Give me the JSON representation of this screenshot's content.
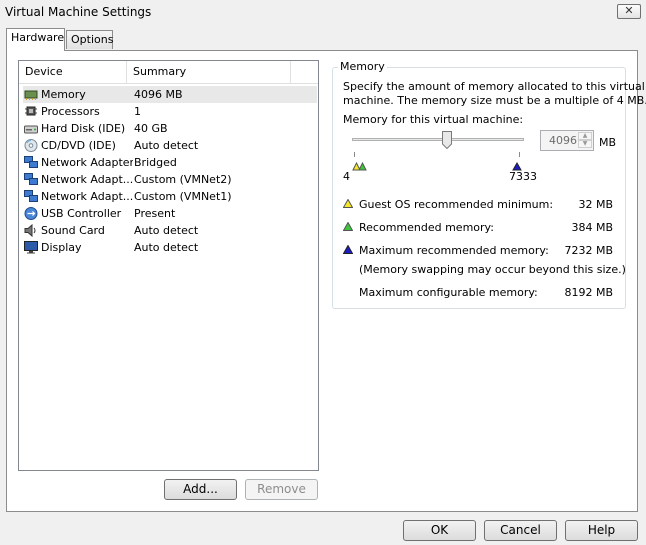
{
  "window": {
    "title": "Virtual Machine Settings"
  },
  "tabs": [
    {
      "label": "Hardware",
      "active": true
    },
    {
      "label": "Options",
      "active": false
    }
  ],
  "device_table": {
    "columns": [
      "Device",
      "Summary"
    ],
    "rows": [
      {
        "device": "Memory",
        "summary": "4096 MB",
        "icon": "memory-icon",
        "selected": true
      },
      {
        "device": "Processors",
        "summary": "1",
        "icon": "processor-icon"
      },
      {
        "device": "Hard Disk (IDE)",
        "summary": "40 GB",
        "icon": "hard-disk-icon"
      },
      {
        "device": "CD/DVD (IDE)",
        "summary": "Auto detect",
        "icon": "cd-dvd-icon"
      },
      {
        "device": "Network Adapter",
        "summary": "Bridged",
        "icon": "network-adapter-icon"
      },
      {
        "device": "Network Adapt...",
        "summary": "Custom (VMNet2)",
        "icon": "network-adapter-icon"
      },
      {
        "device": "Network Adapt...",
        "summary": "Custom (VMNet1)",
        "icon": "network-adapter-icon"
      },
      {
        "device": "USB Controller",
        "summary": "Present",
        "icon": "usb-icon"
      },
      {
        "device": "Sound Card",
        "summary": "Auto detect",
        "icon": "speaker-icon"
      },
      {
        "device": "Display",
        "summary": "Auto detect",
        "icon": "monitor-icon"
      }
    ]
  },
  "list_buttons": {
    "add": "Add...",
    "remove": "Remove"
  },
  "memory": {
    "group_title": "Memory",
    "description": [
      "Specify the amount of memory allocated to this virtual",
      "machine. The memory size must be a multiple of 4 MB."
    ],
    "field_label": "Memory for this virtual machine:",
    "value": "4096",
    "unit": "MB",
    "slider_min_label": "4",
    "slider_max_label": "7333",
    "legend": [
      {
        "label": "Guest OS recommended minimum:",
        "value": "32 MB",
        "color": "#f5e829"
      },
      {
        "label": "Recommended memory:",
        "value": "384 MB",
        "color": "#3fc43f"
      },
      {
        "label": "Maximum recommended memory:",
        "value": "7232 MB",
        "color": "#1c1cc4"
      }
    ],
    "note": "(Memory swapping may occur beyond this size.)",
    "max_config": {
      "label": "Maximum configurable memory:",
      "value": "8192 MB"
    }
  },
  "dialog_buttons": {
    "ok": "OK",
    "cancel": "Cancel",
    "help": "Help"
  }
}
